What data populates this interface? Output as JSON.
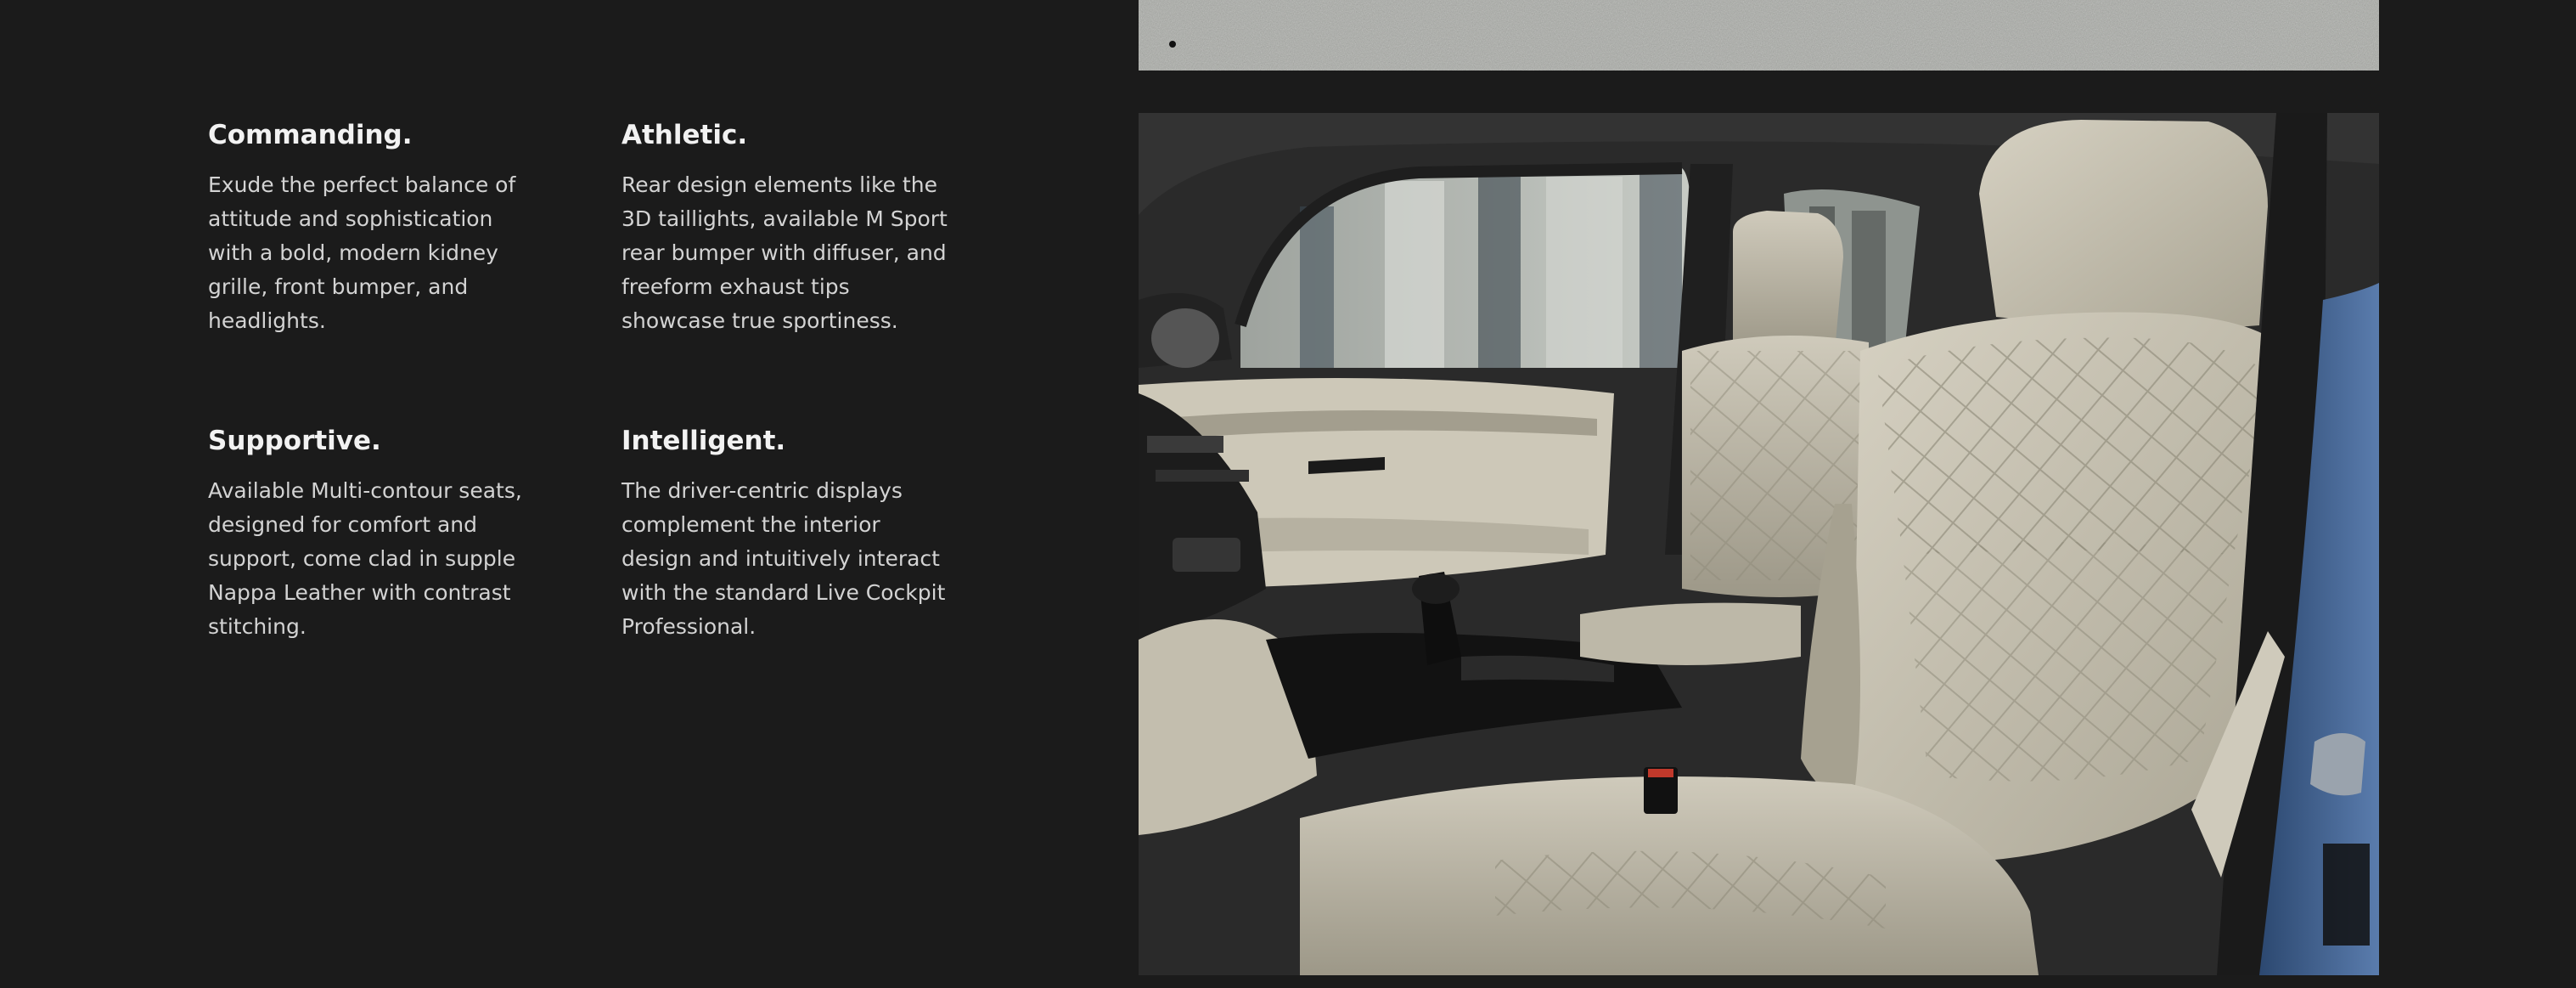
{
  "features": [
    {
      "title": "Commanding.",
      "text": "Exude the perfect balance of attitude and sophistication with a bold, modern kidney grille, front bumper, and headlights."
    },
    {
      "title": "Athletic.",
      "text": "Rear design elements like the 3D taillights, available M Sport rear bumper with diffuser, and freeform exhaust tips showcase true sportiness."
    },
    {
      "title": "Supportive.",
      "text": "Available Multi-contour seats, designed for comfort and support, come clad in supple Nappa Leather with contrast stitching."
    },
    {
      "title": "Intelligent.",
      "text": "The driver-centric displays complement the interior design and intuitively interact with the standard Live Cockpit Professional."
    }
  ],
  "colors": {
    "background": "#1b1b1b",
    "heading": "#f2f2f2",
    "body_text": "#d3d3d3",
    "seat_leather": "#c9c4b4",
    "car_paint": "#3f5f8f"
  }
}
